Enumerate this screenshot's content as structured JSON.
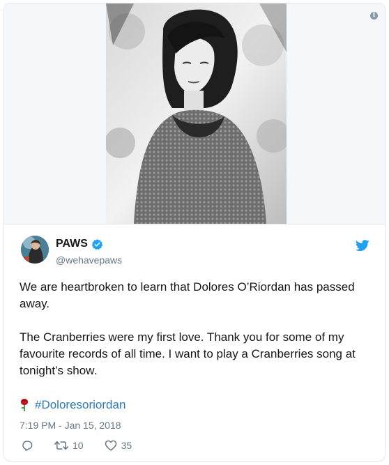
{
  "tweet": {
    "author": {
      "name": "PAWS",
      "handle": "@wehavepaws",
      "verified": true
    },
    "paragraphs": [
      "We are heartbroken to learn that Dolores O’Riordan has passed away.",
      "The Cranberries were my first love. Thank you for some of my favourite records of all time. I want to play a Cranberries song at tonight’s show."
    ],
    "hashtag": "#Doloresoriordan",
    "timestamp": "7:19 PM - Jan 15, 2018",
    "stats": {
      "retweets": "10",
      "likes": "35"
    }
  },
  "media": {
    "icon": "info-icon"
  },
  "colors": {
    "twitter_blue": "#1da1f2",
    "link_blue": "#2b7bb9",
    "secondary_text": "#657786",
    "primary_text": "#14171a",
    "border": "#e1e8ed"
  }
}
